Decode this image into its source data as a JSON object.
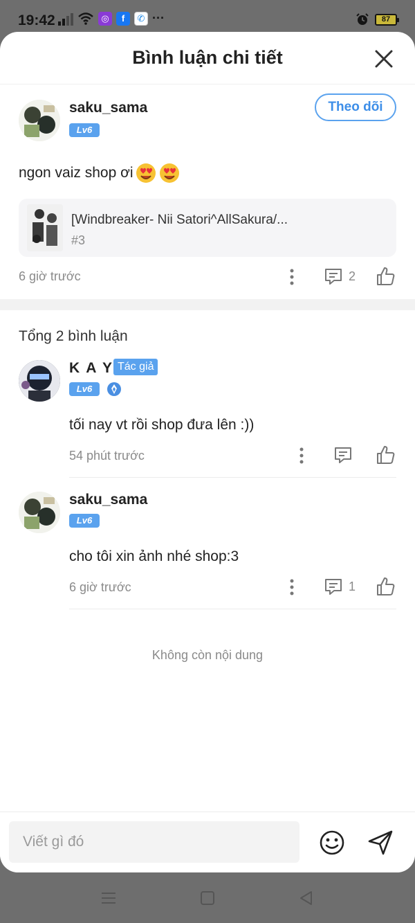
{
  "status_bar": {
    "time": "19:42",
    "battery": "87",
    "more_indicator": "···"
  },
  "header": {
    "title": "Bình luận chi tiết"
  },
  "post": {
    "username": "saku_sama",
    "level": "Lv6",
    "follow_label": "Theo dõi",
    "text": "ngon vaiz shop ơi",
    "reference": {
      "title": "[Windbreaker- Nii Satori^AllSakura/...",
      "chapter": "#3"
    },
    "time": "6 giờ trước",
    "reply_count": "2"
  },
  "comments_section": {
    "total_label": "Tổng 2 bình luận",
    "comments": [
      {
        "username": "K A Y",
        "author_tag": "Tác giả",
        "level": "Lv6",
        "text": "tối nay vt rồi shop đưa lên :))",
        "time": "54 phút trước",
        "reply_count": ""
      },
      {
        "username": "saku_sama",
        "level": "Lv6",
        "text": "cho tôi xin ảnh nhé shop:3",
        "time": "6 giờ trước",
        "reply_count": "1"
      }
    ],
    "end_note": "Không còn nội dung"
  },
  "composer": {
    "placeholder": "Viết gì đó"
  },
  "colors": {
    "accent": "#5aa2ee",
    "status_bg": "#6e6e6e",
    "muted_text": "#8a8a8a"
  }
}
